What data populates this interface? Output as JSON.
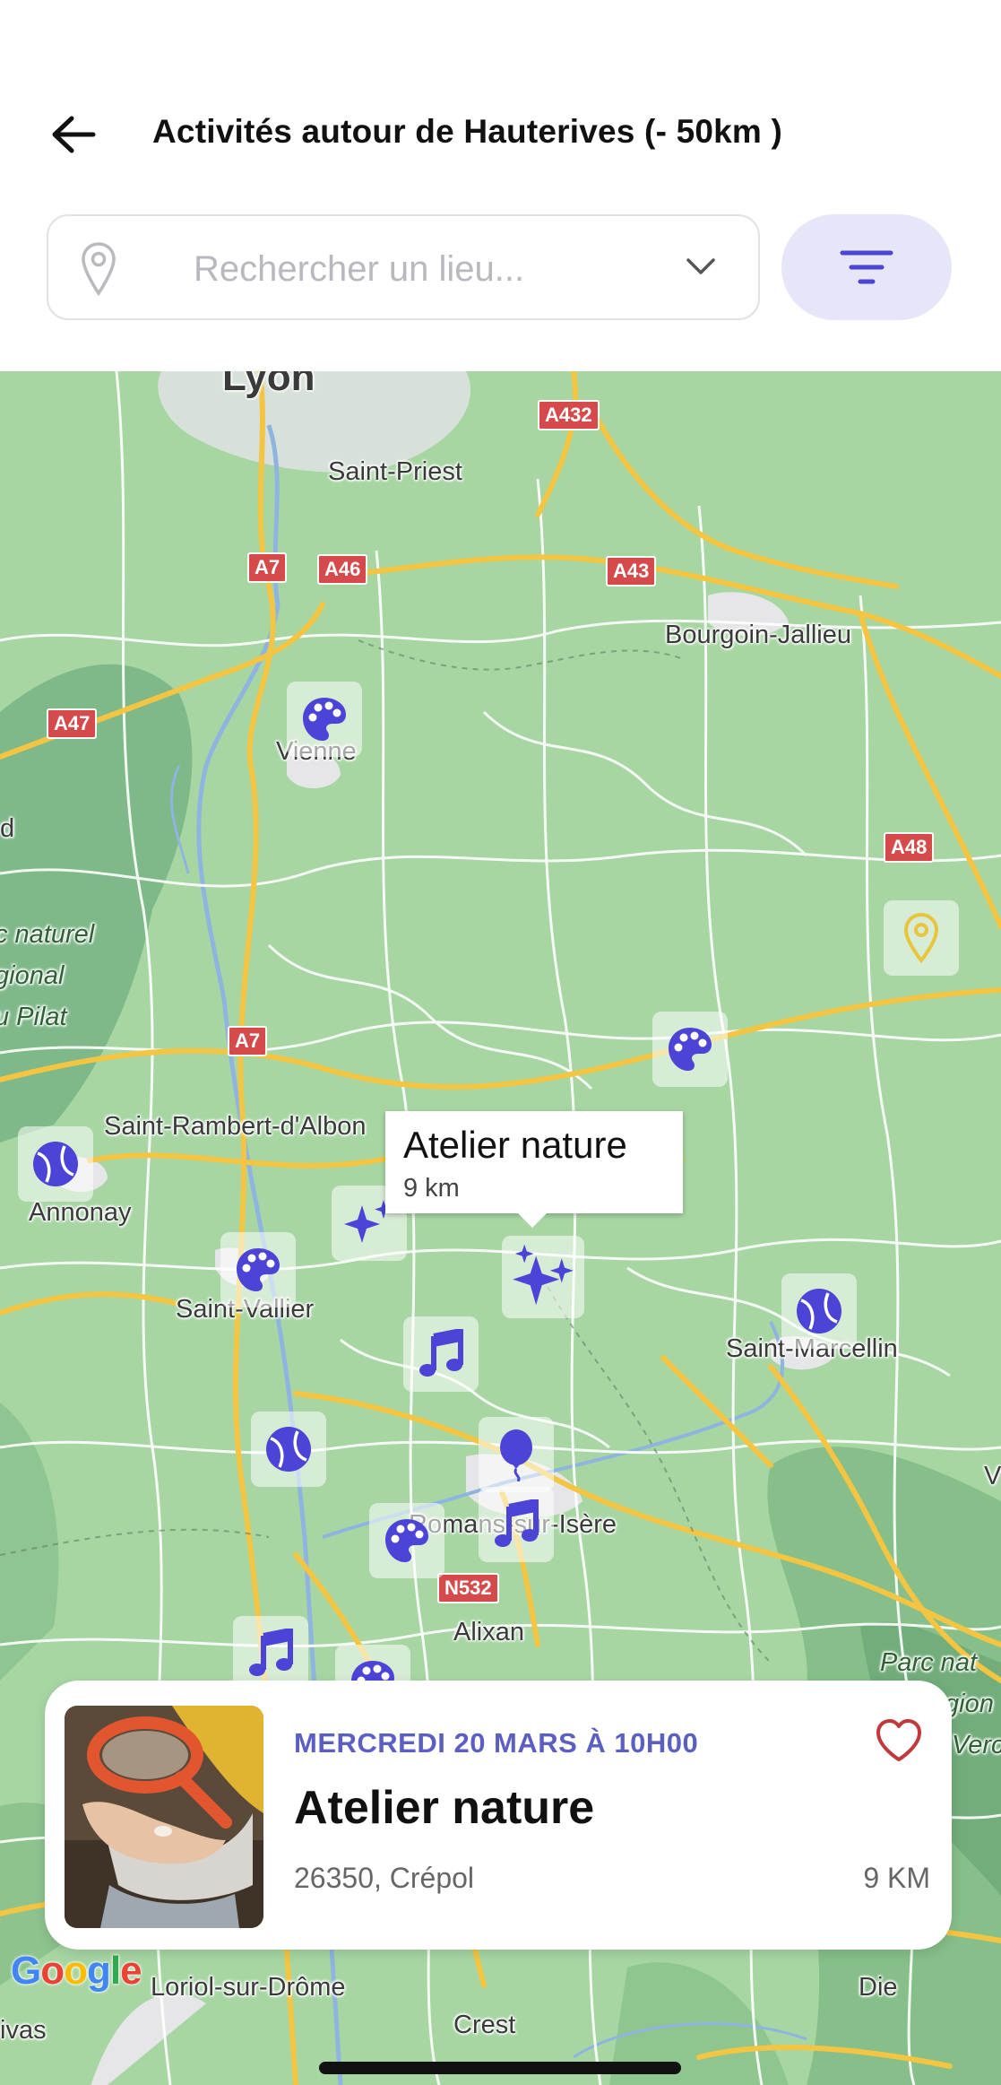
{
  "header": {
    "title": "Activités autour de Hauterives (- 50km )",
    "search_placeholder": "Rechercher un lieu..."
  },
  "map": {
    "places": {
      "lyon": "Lyon",
      "saint_priest": "Saint-Priest",
      "bourgoin": "Bourgoin-Jallieu",
      "vienne": "Vienne",
      "parc_pilat_1": "c naturel",
      "parc_pilat_2": "gional",
      "parc_pilat_3": "u Pilat",
      "d_edge": "d",
      "saint_rambert": "Saint-Rambert-d'Albon",
      "annonay": "Annonay",
      "saint_vallier": "Saint-Vallier",
      "saint_marcellin": "Saint-Marcellin",
      "romans": "Romans-sur-Isère",
      "alixan": "Alixan",
      "v_edge": "V",
      "parc_vercors_1": "Parc nat",
      "parc_vercors_2": "gion",
      "parc_vercors_3": "Verc",
      "loriol": "Loriol-sur-Drôme",
      "crest": "Crest",
      "die": "Die",
      "livas": "ivas"
    },
    "roads": {
      "a432": "A432",
      "a7_top": "A7",
      "a46": "A46",
      "a43": "A43",
      "a47": "A47",
      "a48": "A48",
      "a7_mid": "A7",
      "n532": "N532"
    },
    "markers": [
      {
        "icon": "palette-icon"
      },
      {
        "icon": "palette-icon"
      },
      {
        "icon": "tennis-ball-icon"
      },
      {
        "icon": "sparkles-icon"
      },
      {
        "icon": "palette-icon"
      },
      {
        "icon": "sparkles-icon"
      },
      {
        "icon": "tennis-ball-icon"
      },
      {
        "icon": "music-note-icon"
      },
      {
        "icon": "tennis-ball-icon"
      },
      {
        "icon": "balloon-icon"
      },
      {
        "icon": "palette-icon"
      },
      {
        "icon": "music-note-icon"
      },
      {
        "icon": "music-note-icon"
      },
      {
        "icon": "palette-icon"
      }
    ],
    "tooltip": {
      "title": "Atelier nature",
      "distance": "9 km"
    },
    "google_logo": "Google"
  },
  "card": {
    "date": "MERCREDI 20 MARS À 10H00",
    "name": "Atelier nature",
    "location": "26350, Crépol",
    "distance": "9 KM"
  },
  "colors": {
    "accent": "#4b44d6",
    "accent_soft": "#e6e6f8",
    "date_text": "#5b5fc2",
    "heart": "#c0393b",
    "map_green": "#9fcf9c"
  }
}
